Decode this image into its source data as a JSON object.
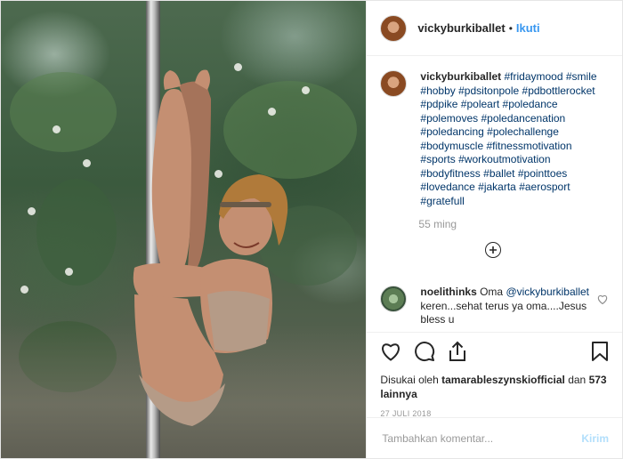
{
  "header": {
    "username": "vickyburkiballet",
    "separator": "•",
    "follow_label": "Ikuti"
  },
  "caption": {
    "username": "vickyburkiballet",
    "hashtags": [
      "#fridaymood",
      "#smile",
      "#hobby",
      "#pdsitonpole",
      "#pdbottlerocket",
      "#pdpike",
      "#poleart",
      "#poledance",
      "#polemoves",
      "#poledancenation",
      "#poledancing",
      "#polechallenge",
      "#bodymuscle",
      "#fitnessmotivation",
      "#sports",
      "#workoutmotivation",
      "#bodyfitness",
      "#ballet",
      "#pointtoes",
      "#lovedance",
      "#jakarta",
      "#aerosport",
      "#gratefull"
    ],
    "time": "55 ming"
  },
  "comment": {
    "username": "noelithinks",
    "text_lead": "Oma",
    "mention": "@vickyburkiballet",
    "text_rest": "keren...sehat terus ya oma....Jesus bless u"
  },
  "likes": {
    "prefix": "Disukai oleh",
    "user": "tamarableszynskiofficial",
    "connector": "dan",
    "others": "573 lainnya"
  },
  "date": "27 JULI 2018",
  "add_comment": {
    "placeholder": "Tambahkan komentar...",
    "post_label": "Kirim"
  },
  "icons": {
    "like": "heart-icon",
    "comment": "comment-icon",
    "share": "share-icon",
    "save": "bookmark-icon",
    "load_more": "plus-circle-icon",
    "comment_like": "heart-icon"
  },
  "colors": {
    "link": "#3897f0",
    "hashtag": "#003569",
    "muted": "#999999",
    "post_disabled": "#b2dffc"
  }
}
